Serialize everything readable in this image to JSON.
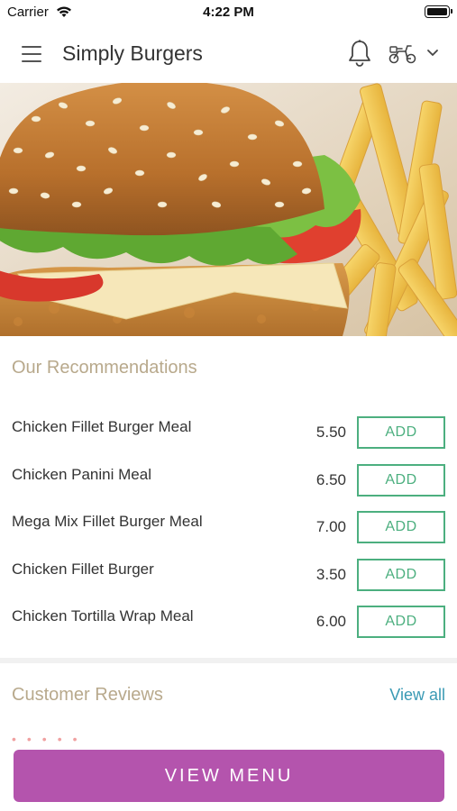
{
  "status_bar": {
    "carrier": "Carrier",
    "time": "4:22 PM"
  },
  "header": {
    "title": "Simply Burgers",
    "icons": [
      "menu-icon",
      "bell-icon",
      "scooter-icon",
      "chevron-down-icon"
    ]
  },
  "recommendations": {
    "title": "Our Recommendations",
    "add_label": "ADD",
    "items": [
      {
        "name": "Chicken Fillet Burger Meal",
        "price": "5.50"
      },
      {
        "name": "Chicken Panini Meal",
        "price": "6.50"
      },
      {
        "name": "Mega Mix Fillet Burger Meal",
        "price": "7.00"
      },
      {
        "name": "Chicken Fillet Burger",
        "price": "3.50"
      },
      {
        "name": "Chicken Tortilla Wrap Meal",
        "price": "6.00"
      }
    ]
  },
  "reviews": {
    "title": "Customer Reviews",
    "view_all": "View all"
  },
  "cta": {
    "label": "VIEW MENU"
  },
  "colors": {
    "accent": "#b454ad",
    "add_green": "#4caf7f",
    "section_title": "#b8a98c",
    "link_blue": "#3a9ab4"
  }
}
